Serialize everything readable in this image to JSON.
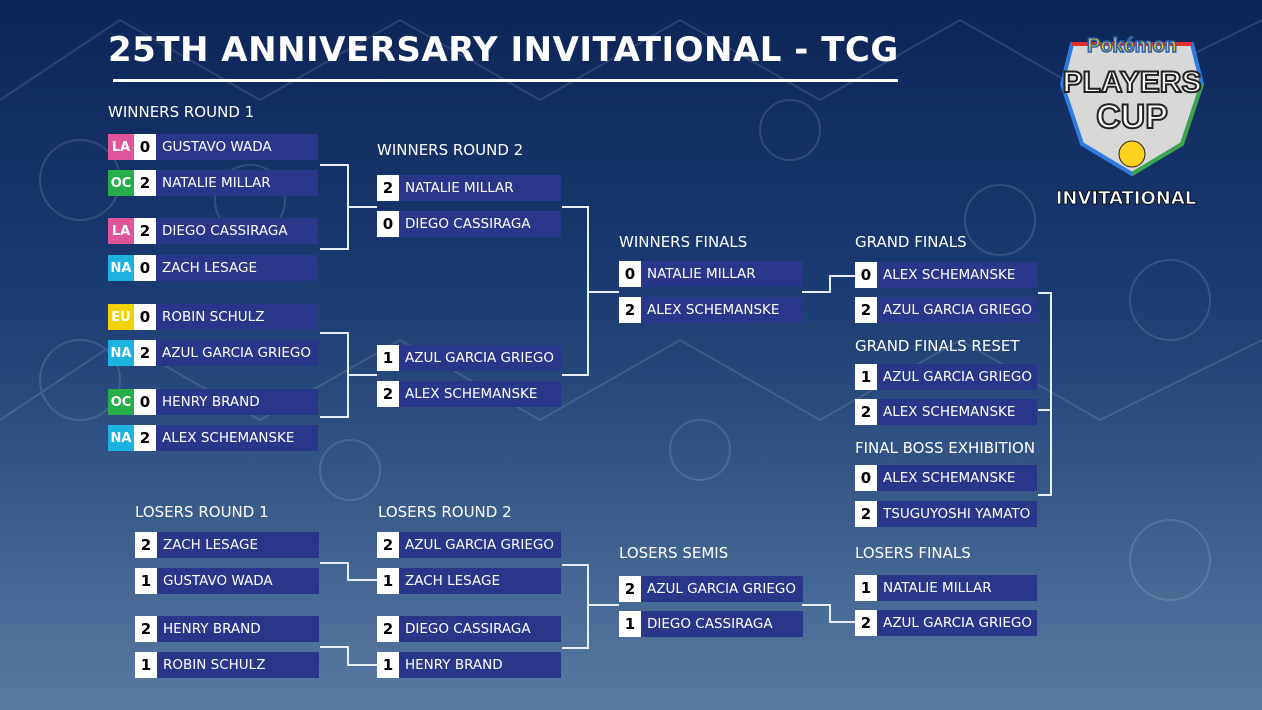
{
  "title": "25TH ANNIVERSARY INVITATIONAL - TCG",
  "logo": {
    "brand": "Pokémon",
    "line1": "PLAYERS",
    "line2": "CUP",
    "subtitle": "INVITATIONAL"
  },
  "region_colors": {
    "LA": "#e0559a",
    "OC": "#27ad4b",
    "NA": "#1db2e0",
    "EU": "#f0d300"
  },
  "rounds": [
    {
      "label": "WINNERS ROUND 1",
      "entries": [
        {
          "region": "LA",
          "score": "0",
          "name": "GUSTAVO WADA"
        },
        {
          "region": "OC",
          "score": "2",
          "name": "NATALIE MILLAR"
        },
        {
          "region": "LA",
          "score": "2",
          "name": "DIEGO CASSIRAGA"
        },
        {
          "region": "NA",
          "score": "0",
          "name": "ZACH LESAGE"
        },
        {
          "region": "EU",
          "score": "0",
          "name": "ROBIN SCHULZ"
        },
        {
          "region": "NA",
          "score": "2",
          "name": "AZUL GARCIA GRIEGO"
        },
        {
          "region": "OC",
          "score": "0",
          "name": "HENRY BRAND"
        },
        {
          "region": "NA",
          "score": "2",
          "name": "ALEX SCHEMANSKE"
        }
      ]
    },
    {
      "label": "WINNERS ROUND 2",
      "entries": [
        {
          "score": "2",
          "name": "NATALIE MILLAR"
        },
        {
          "score": "0",
          "name": "DIEGO CASSIRAGA"
        },
        {
          "score": "1",
          "name": "AZUL GARCIA GRIEGO"
        },
        {
          "score": "2",
          "name": "ALEX SCHEMANSKE"
        }
      ]
    },
    {
      "label": "WINNERS FINALS",
      "entries": [
        {
          "score": "0",
          "name": "NATALIE MILLAR"
        },
        {
          "score": "2",
          "name": "ALEX SCHEMANSKE"
        }
      ]
    },
    {
      "label": "GRAND FINALS",
      "entries": [
        {
          "score": "0",
          "name": "ALEX SCHEMANSKE"
        },
        {
          "score": "2",
          "name": "AZUL GARCIA GRIEGO"
        }
      ]
    },
    {
      "label": "GRAND FINALS RESET",
      "entries": [
        {
          "score": "1",
          "name": "AZUL GARCIA GRIEGO"
        },
        {
          "score": "2",
          "name": "ALEX SCHEMANSKE"
        }
      ]
    },
    {
      "label": "FINAL BOSS EXHIBITION",
      "entries": [
        {
          "score": "0",
          "name": "ALEX SCHEMANSKE"
        },
        {
          "score": "2",
          "name": "TSUGUYOSHI YAMATO"
        }
      ]
    },
    {
      "label": "LOSERS ROUND 1",
      "entries": [
        {
          "score": "2",
          "name": "ZACH LESAGE"
        },
        {
          "score": "1",
          "name": "GUSTAVO WADA"
        },
        {
          "score": "2",
          "name": "HENRY BRAND"
        },
        {
          "score": "1",
          "name": "ROBIN SCHULZ"
        }
      ]
    },
    {
      "label": "LOSERS ROUND 2",
      "entries": [
        {
          "score": "2",
          "name": "AZUL GARCIA GRIEGO"
        },
        {
          "score": "1",
          "name": "ZACH LESAGE"
        },
        {
          "score": "2",
          "name": "DIEGO CASSIRAGA"
        },
        {
          "score": "1",
          "name": "HENRY BRAND"
        }
      ]
    },
    {
      "label": "LOSERS SEMIS",
      "entries": [
        {
          "score": "2",
          "name": "AZUL GARCIA GRIEGO"
        },
        {
          "score": "1",
          "name": "DIEGO CASSIRAGA"
        }
      ]
    },
    {
      "label": "LOSERS FINALS",
      "entries": [
        {
          "score": "1",
          "name": "NATALIE MILLAR"
        },
        {
          "score": "2",
          "name": "AZUL GARCIA GRIEGO"
        }
      ]
    }
  ]
}
